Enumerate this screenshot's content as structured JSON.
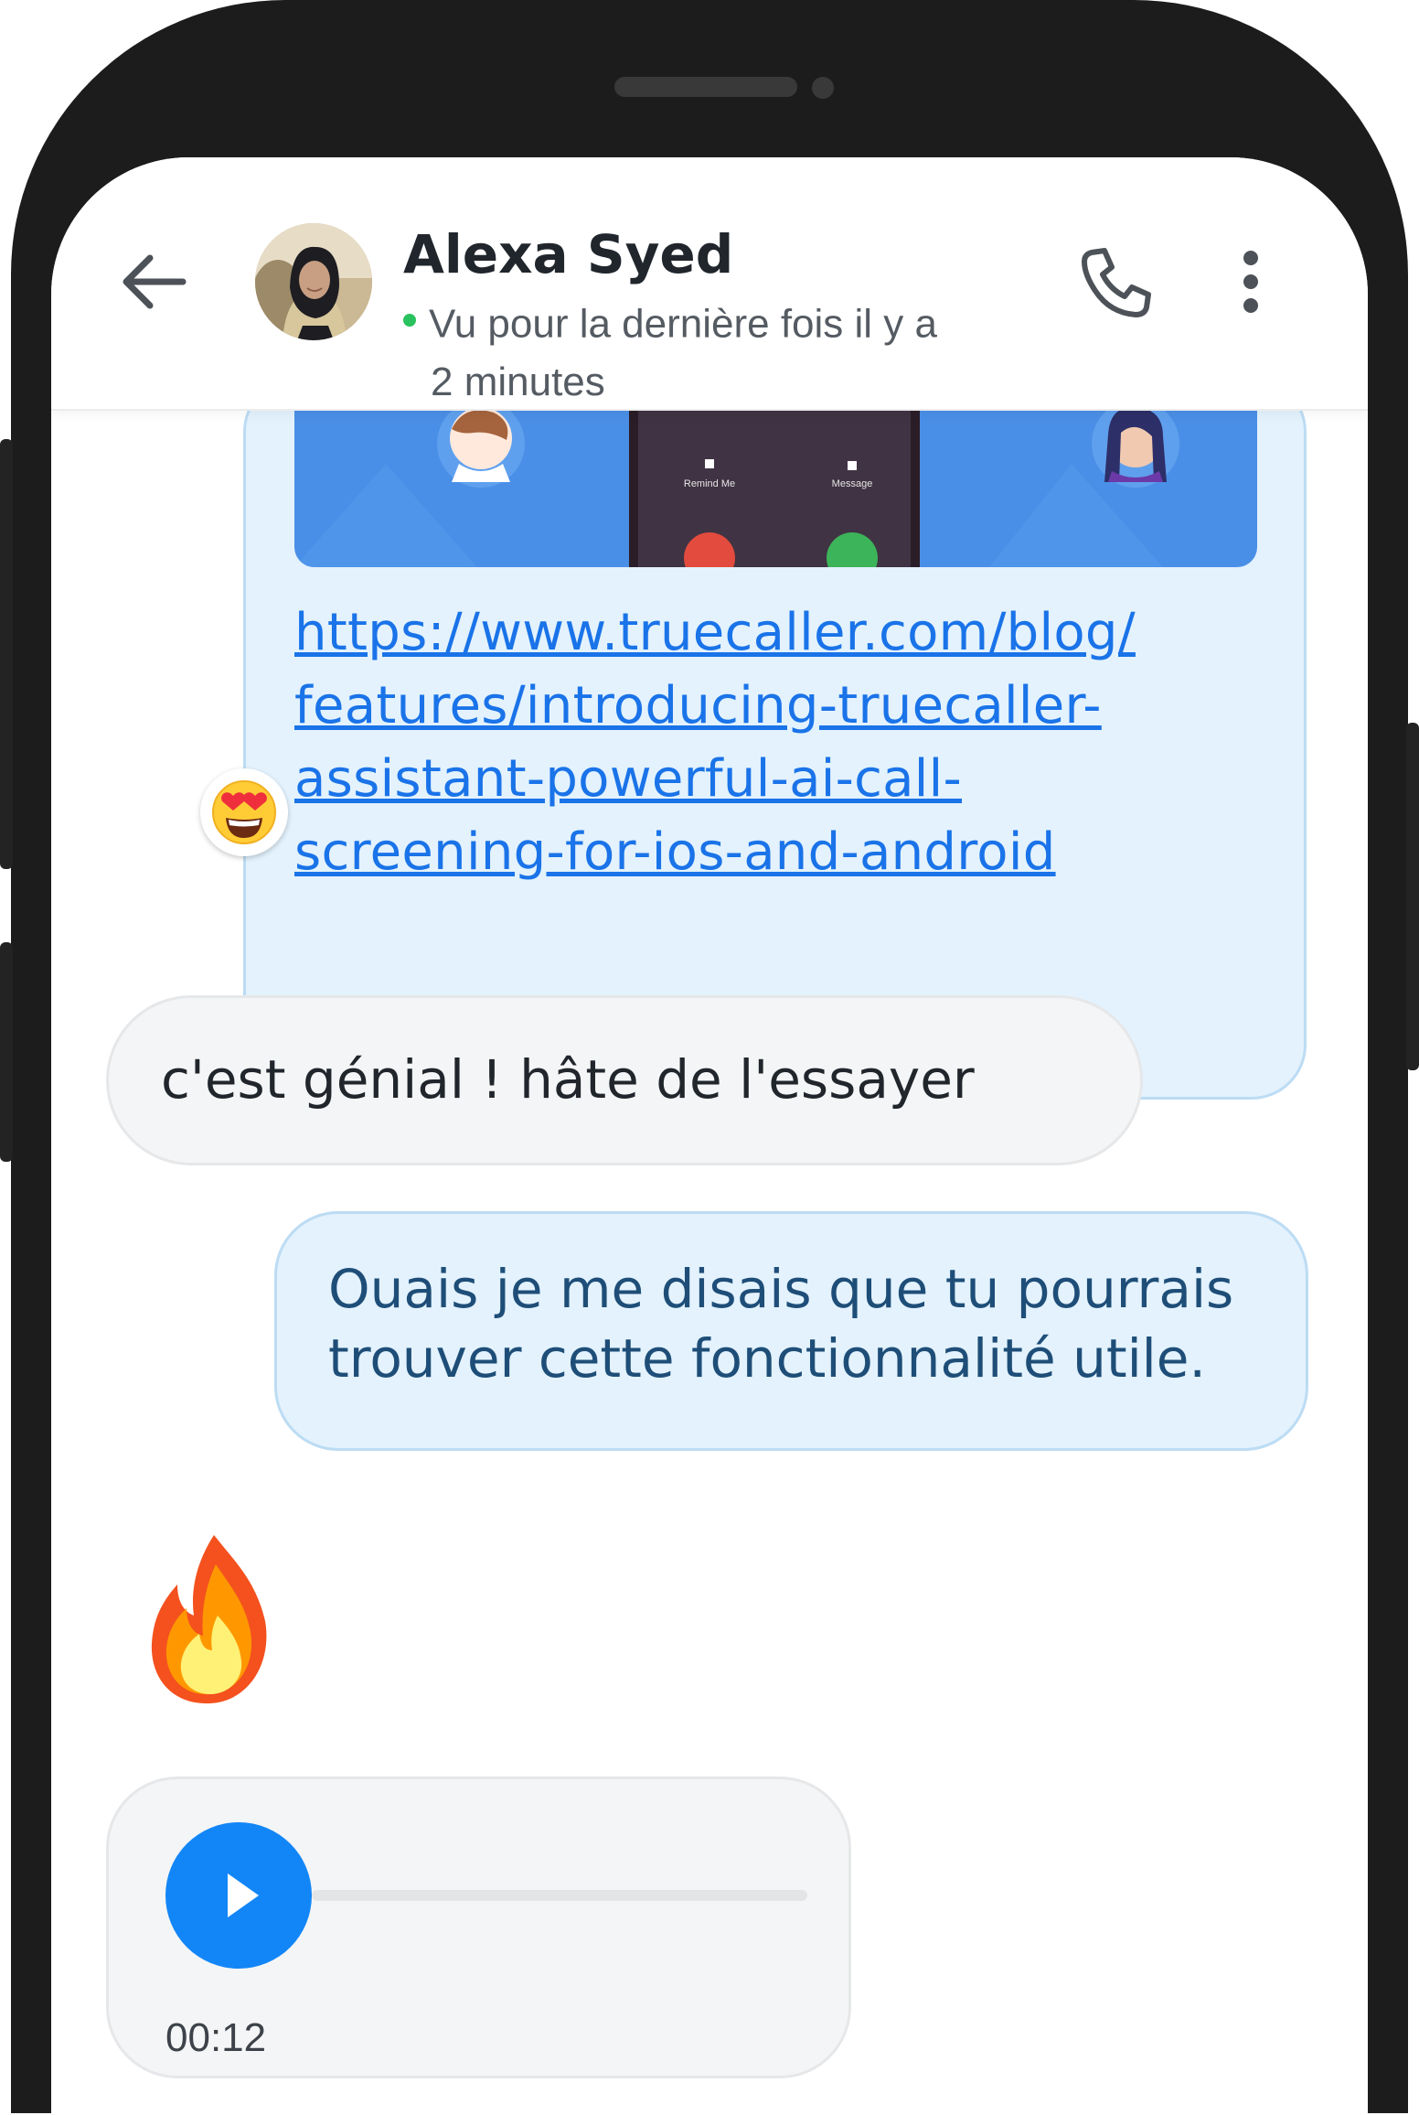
{
  "contact": {
    "name": "Alexa Syed",
    "status_line1": "Vu pour la dernière fois il y a",
    "status_line2": "2 minutes",
    "online_color": "#2ac25e"
  },
  "header_icons": [
    "back-arrow-icon",
    "phone-icon",
    "more-vertical-icon"
  ],
  "messages": {
    "link": {
      "url_lines": [
        "https://www.truecaller.com/blog/",
        "features/introducing-truecaller-",
        "assistant-powerful-ai-call-",
        "screening-for-ios-and-android"
      ],
      "preview_labels": [
        "Remind Me",
        "Message"
      ],
      "reaction": "😍"
    },
    "incoming_text": "c'est génial ! hâte de l'essayer",
    "outgoing_lines": [
      "Ouais je me disais que tu pourrais",
      "trouver cette fonctionnalité utile."
    ],
    "emoji": "🔥",
    "audio": {
      "duration": "00:12",
      "progress": 0
    }
  },
  "colors": {
    "accent": "#1286f7",
    "link": "#1a73e8",
    "outgoing_bubble": "#e3f2fd",
    "incoming_bubble": "#f4f5f6"
  }
}
